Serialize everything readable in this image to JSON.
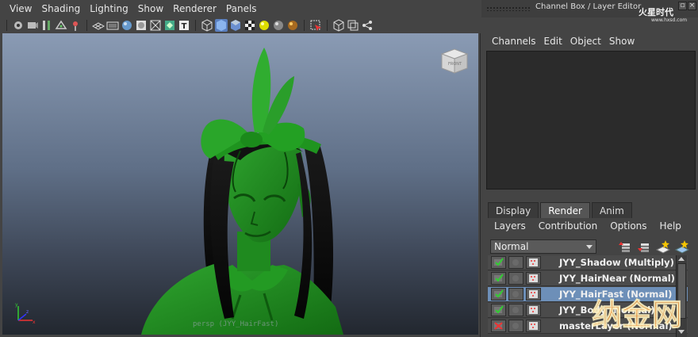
{
  "viewport_menu": [
    "View",
    "Shading",
    "Lighting",
    "Show",
    "Renderer",
    "Panels"
  ],
  "viewport_toolbar_icons": [
    "camera-select-icon",
    "camera-attributes-icon",
    "bookmark-icon",
    "image-plane-icon",
    "2d-pan-icon",
    "grid-icon",
    "film-gate-icon",
    "resolution-gate-icon",
    "wireframe-icon",
    "smooth-shade-icon",
    "wireframe-on-shaded-icon",
    "textured-icon",
    "use-all-lights-icon",
    "shadows-icon",
    "xray-icon",
    "isolate-select-icon",
    "default-material-icon",
    "high-quality-icon",
    "ambient-occlusion-icon",
    "select-camera-icon",
    "view-cube-toggle-icon",
    "backface-culling-icon",
    "component-mode-icon"
  ],
  "viewport": {
    "viewcube_label": "FRONT",
    "camera_label": "persp (JYY_HairFast)"
  },
  "channel_box": {
    "title": "Channel Box / Layer Editor",
    "menu": [
      "Channels",
      "Edit",
      "Object",
      "Show"
    ]
  },
  "layer_editor": {
    "tabs": [
      "Display",
      "Render",
      "Anim"
    ],
    "active_tab": "Render",
    "menu": [
      "Layers",
      "Contribution",
      "Options",
      "Help"
    ],
    "blend_mode": "Normal",
    "layers": [
      {
        "name": "JYY_Shadow (Multiply)",
        "selected": false
      },
      {
        "name": "JYY_HairNear (Normal)",
        "selected": false
      },
      {
        "name": "JYY_HairFast (Normal)",
        "selected": true
      },
      {
        "name": "JYY_Body (Normal)",
        "selected": false
      },
      {
        "name": "masterLayer (Normal)",
        "selected": false
      }
    ]
  },
  "watermarks": {
    "top": "火星时代",
    "top_url": "www.hxsd.com",
    "bottom": "纳金网"
  },
  "colors": {
    "character_green": "#1f8a1f",
    "selection_blue": "#6d8fb8",
    "viewport_top": "#8a9bb4",
    "viewport_bottom": "#22272f"
  }
}
